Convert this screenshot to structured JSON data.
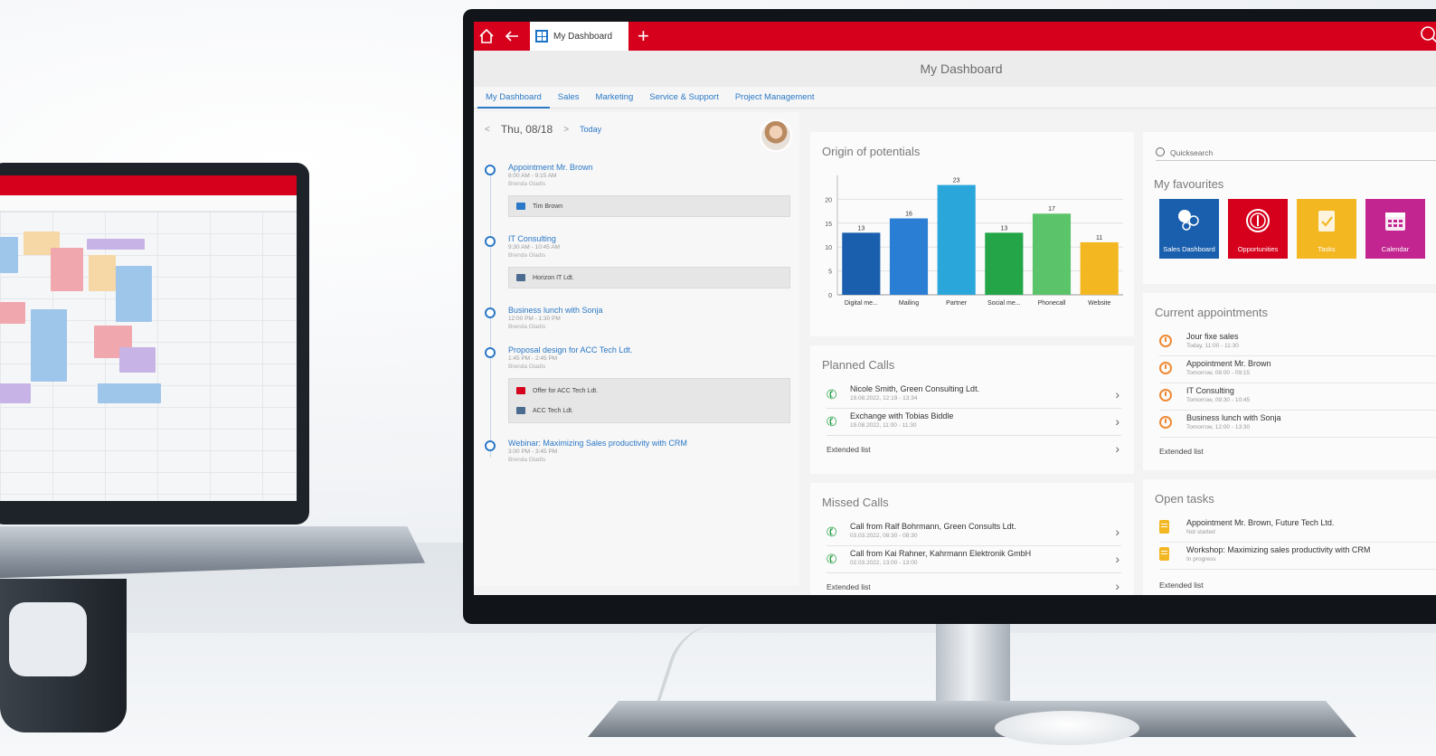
{
  "app": {
    "tab_label": "My Dashboard",
    "page_title": "My Dashboard",
    "accent_color": "#d6001c",
    "link_color": "#2a78c6"
  },
  "nav": {
    "tabs": [
      "My Dashboard",
      "Sales",
      "Marketing",
      "Service & Support",
      "Project Management"
    ],
    "active_index": 0
  },
  "agenda": {
    "date": "Thu, 08/18",
    "today_label": "Today",
    "items": [
      {
        "title": "Appointment Mr. Brown",
        "time": "8:00 AM - 9:15 AM",
        "who": "Brenda Gladis",
        "attachments": [
          "Tim Brown"
        ]
      },
      {
        "title": "IT Consulting",
        "time": "9:30 AM - 10:45 AM",
        "who": "Brenda Gladis",
        "attachments": [
          "Horizon IT Ldt."
        ]
      },
      {
        "title": "Business lunch with Sonja",
        "time": "12:00 PM - 1:30 PM",
        "who": "Brenda Gladis",
        "attachments": []
      },
      {
        "title": "Proposal design for ACC Tech Ldt.",
        "time": "1:45 PM - 2:45 PM",
        "who": "Brenda Gladis",
        "attachments": [
          "Offer for ACC Tech Ldt.",
          "ACC Tech Ldt."
        ]
      },
      {
        "title": "Webinar: Maximizing Sales productivity with CRM",
        "time": "3:00 PM - 3:45 PM",
        "who": "Brenda Gladis",
        "attachments": []
      }
    ]
  },
  "chart_panel": {
    "title": "Origin of potentials"
  },
  "chart_data": {
    "type": "bar",
    "title": "Origin of potentials",
    "categories": [
      "Digital me...",
      "Mailing",
      "Partner",
      "Social me...",
      "Phonecall",
      "Website"
    ],
    "values": [
      13,
      16,
      23,
      13,
      17,
      11
    ],
    "colors": [
      "#1a5fae",
      "#2a7fd4",
      "#2aa6db",
      "#23a548",
      "#5bc46b",
      "#f3b721"
    ],
    "ylim": [
      0,
      25
    ],
    "yticks": [
      0,
      5,
      10,
      15,
      20
    ],
    "grid": true
  },
  "planned_calls": {
    "title": "Planned Calls",
    "items": [
      {
        "title": "Nicole Smith, Green Consulting Ldt.",
        "sub": "19.08.2022, 12:19 - 13:34"
      },
      {
        "title": "Exchange with Tobias Biddle",
        "sub": "19.08.2022, 11:00 - 11:30"
      }
    ],
    "extended": "Extended list"
  },
  "missed_calls": {
    "title": "Missed Calls",
    "items": [
      {
        "title": "Call from Ralf Bohrmann, Green Consults Ldt.",
        "sub": "03.03.2022, 08:30 - 08:30"
      },
      {
        "title": "Call from Kai Rahner, Kahrmann Elektronik GmbH",
        "sub": "02.03.2022, 13:00 - 13:00"
      }
    ],
    "extended": "Extended list"
  },
  "quicksearch": {
    "placeholder": "Quicksearch"
  },
  "favourites": {
    "title": "My favourites",
    "tiles": [
      {
        "label": "Sales Dashboard",
        "color": "#1a5fae",
        "icon": "sales-dashboard-icon"
      },
      {
        "label": "Opportunities",
        "color": "#d6001c",
        "icon": "opportunities-icon"
      },
      {
        "label": "Tasks",
        "color": "#f3b721",
        "icon": "tasks-icon"
      },
      {
        "label": "Calendar",
        "color": "#c2258f",
        "icon": "calendar-icon"
      }
    ]
  },
  "current_appointments": {
    "title": "Current appointments",
    "items": [
      {
        "title": "Jour fixe sales",
        "sub": "Today, 11:00 - 11:30"
      },
      {
        "title": "Appointment Mr. Brown",
        "sub": "Tomorrow, 08:00 - 09:15"
      },
      {
        "title": "IT Consulting",
        "sub": "Tomorrow, 09:30 - 10:45"
      },
      {
        "title": "Business lunch with Sonja",
        "sub": "Tomorrow, 12:00 - 13:30"
      }
    ],
    "extended": "Extended list"
  },
  "open_tasks": {
    "title": "Open tasks",
    "items": [
      {
        "title": "Appointment Mr. Brown, Future Tech Ltd.",
        "sub": "Not started"
      },
      {
        "title": "Workshop: Maximizing sales productivity with CRM",
        "sub": "In progress"
      }
    ],
    "extended": "Extended list"
  }
}
